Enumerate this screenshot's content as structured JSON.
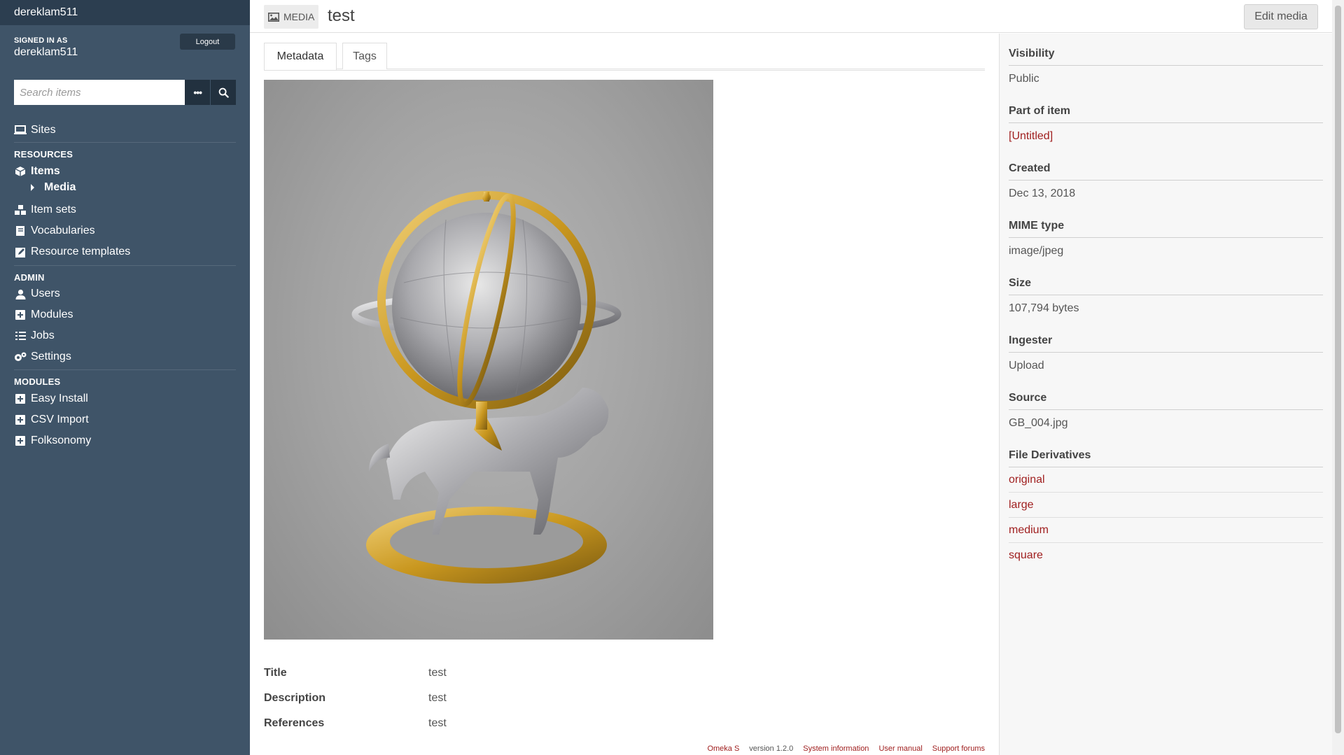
{
  "sidebar": {
    "top_user": "dereklam511",
    "signed_in_label": "SIGNED IN AS",
    "signed_in_user": "dereklam511",
    "logout_label": "Logout",
    "search_placeholder": "Search items",
    "sites_label": "Sites",
    "resources_heading": "RESOURCES",
    "items_label": "Items",
    "media_label": "Media",
    "item_sets_label": "Item sets",
    "vocabularies_label": "Vocabularies",
    "resource_templates_label": "Resource templates",
    "admin_heading": "ADMIN",
    "users_label": "Users",
    "modules_label": "Modules",
    "jobs_label": "Jobs",
    "settings_label": "Settings",
    "modules_heading": "MODULES",
    "easy_install_label": "Easy Install",
    "csv_import_label": "CSV Import",
    "folksonomy_label": "Folksonomy"
  },
  "header": {
    "badge_label": "MEDIA",
    "title": "test",
    "edit_button": "Edit media"
  },
  "tabs": [
    {
      "label": "Metadata",
      "active": true
    },
    {
      "label": "Tags",
      "active": false
    }
  ],
  "properties": [
    {
      "key": "Title",
      "value": "test"
    },
    {
      "key": "Description",
      "value": "test"
    },
    {
      "key": "References",
      "value": "test"
    }
  ],
  "meta": {
    "visibility_label": "Visibility",
    "visibility_value": "Public",
    "part_of_item_label": "Part of item",
    "part_of_item_value": "[Untitled]",
    "created_label": "Created",
    "created_value": "Dec 13, 2018",
    "mime_label": "MIME type",
    "mime_value": "image/jpeg",
    "size_label": "Size",
    "size_value": "107,794 bytes",
    "ingester_label": "Ingester",
    "ingester_value": "Upload",
    "source_label": "Source",
    "source_value": "GB_004.jpg",
    "derivatives_label": "File Derivatives",
    "derivatives": [
      "original",
      "large",
      "medium",
      "square"
    ]
  },
  "footer": {
    "brand": "Omeka S",
    "version": "version 1.2.0",
    "system_info": "System information",
    "user_manual": "User manual",
    "support_forums": "Support forums"
  },
  "colors": {
    "sidebar_bg": "#3f5468",
    "sidebar_top_bg": "#2c3e50",
    "link_red": "#a02020"
  }
}
